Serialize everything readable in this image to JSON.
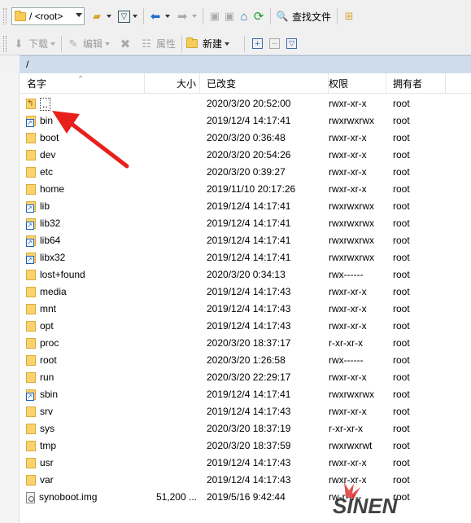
{
  "toolbar": {
    "path_dropdown": "/ <root>",
    "search_files": "查找文件",
    "download": "下载",
    "edit": "编辑",
    "properties": "属性",
    "new": "新建"
  },
  "pathbar": {
    "path": "/"
  },
  "columns": {
    "name": "名字",
    "size": "大小",
    "modified": "已改变",
    "permissions": "权限",
    "owner": "拥有者"
  },
  "files": [
    {
      "name": "..",
      "size": "",
      "modified": "2020/3/20 20:52:00",
      "perm": "rwxr-xr-x",
      "owner": "root",
      "icon": "parent-folder-icon"
    },
    {
      "name": "bin",
      "size": "",
      "modified": "2019/12/4 14:17:41",
      "perm": "rwxrwxrwx",
      "owner": "root",
      "icon": "folder-link-icon"
    },
    {
      "name": "boot",
      "size": "",
      "modified": "2020/3/20 0:36:48",
      "perm": "rwxr-xr-x",
      "owner": "root",
      "icon": "folder-icon"
    },
    {
      "name": "dev",
      "size": "",
      "modified": "2020/3/20 20:54:26",
      "perm": "rwxr-xr-x",
      "owner": "root",
      "icon": "folder-icon"
    },
    {
      "name": "etc",
      "size": "",
      "modified": "2020/3/20 0:39:27",
      "perm": "rwxr-xr-x",
      "owner": "root",
      "icon": "folder-icon"
    },
    {
      "name": "home",
      "size": "",
      "modified": "2019/11/10 20:17:26",
      "perm": "rwxr-xr-x",
      "owner": "root",
      "icon": "folder-icon"
    },
    {
      "name": "lib",
      "size": "",
      "modified": "2019/12/4 14:17:41",
      "perm": "rwxrwxrwx",
      "owner": "root",
      "icon": "folder-link-icon"
    },
    {
      "name": "lib32",
      "size": "",
      "modified": "2019/12/4 14:17:41",
      "perm": "rwxrwxrwx",
      "owner": "root",
      "icon": "folder-link-icon"
    },
    {
      "name": "lib64",
      "size": "",
      "modified": "2019/12/4 14:17:41",
      "perm": "rwxrwxrwx",
      "owner": "root",
      "icon": "folder-link-icon"
    },
    {
      "name": "libx32",
      "size": "",
      "modified": "2019/12/4 14:17:41",
      "perm": "rwxrwxrwx",
      "owner": "root",
      "icon": "folder-link-icon"
    },
    {
      "name": "lost+found",
      "size": "",
      "modified": "2020/3/20 0:34:13",
      "perm": "rwx------",
      "owner": "root",
      "icon": "folder-icon"
    },
    {
      "name": "media",
      "size": "",
      "modified": "2019/12/4 14:17:43",
      "perm": "rwxr-xr-x",
      "owner": "root",
      "icon": "folder-icon"
    },
    {
      "name": "mnt",
      "size": "",
      "modified": "2019/12/4 14:17:43",
      "perm": "rwxr-xr-x",
      "owner": "root",
      "icon": "folder-icon"
    },
    {
      "name": "opt",
      "size": "",
      "modified": "2019/12/4 14:17:43",
      "perm": "rwxr-xr-x",
      "owner": "root",
      "icon": "folder-icon"
    },
    {
      "name": "proc",
      "size": "",
      "modified": "2020/3/20 18:37:17",
      "perm": "r-xr-xr-x",
      "owner": "root",
      "icon": "folder-icon"
    },
    {
      "name": "root",
      "size": "",
      "modified": "2020/3/20 1:26:58",
      "perm": "rwx------",
      "owner": "root",
      "icon": "folder-icon"
    },
    {
      "name": "run",
      "size": "",
      "modified": "2020/3/20 22:29:17",
      "perm": "rwxr-xr-x",
      "owner": "root",
      "icon": "folder-icon"
    },
    {
      "name": "sbin",
      "size": "",
      "modified": "2019/12/4 14:17:41",
      "perm": "rwxrwxrwx",
      "owner": "root",
      "icon": "folder-link-icon"
    },
    {
      "name": "srv",
      "size": "",
      "modified": "2019/12/4 14:17:43",
      "perm": "rwxr-xr-x",
      "owner": "root",
      "icon": "folder-icon"
    },
    {
      "name": "sys",
      "size": "",
      "modified": "2020/3/20 18:37:19",
      "perm": "r-xr-xr-x",
      "owner": "root",
      "icon": "folder-icon"
    },
    {
      "name": "tmp",
      "size": "",
      "modified": "2020/3/20 18:37:59",
      "perm": "rwxrwxrwt",
      "owner": "root",
      "icon": "folder-icon"
    },
    {
      "name": "usr",
      "size": "",
      "modified": "2019/12/4 14:17:43",
      "perm": "rwxr-xr-x",
      "owner": "root",
      "icon": "folder-icon"
    },
    {
      "name": "var",
      "size": "",
      "modified": "2019/12/4 14:17:43",
      "perm": "rwxr-xr-x",
      "owner": "root",
      "icon": "folder-icon"
    },
    {
      "name": "synoboot.img",
      "size": "51,200 ...",
      "modified": "2019/5/16 9:42:44",
      "perm": "rw-r--r--",
      "owner": "root",
      "icon": "file-icon"
    }
  ],
  "annotation": {
    "arrow_color": "#e8201c"
  },
  "watermark": {
    "text": "SINEN"
  }
}
